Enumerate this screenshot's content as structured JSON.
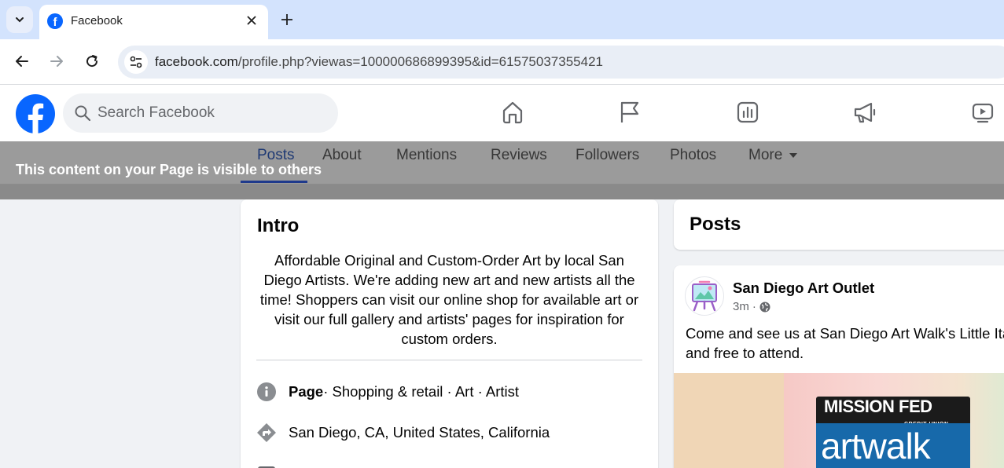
{
  "browser": {
    "tab": {
      "title": "Facebook"
    },
    "url": {
      "domain": "facebook.com",
      "path": "/profile.php?viewas=100000686899395&id=61575037355421"
    }
  },
  "fb": {
    "search": {
      "placeholder": "Search Facebook"
    },
    "logo_letter": "f"
  },
  "profile_tabs": [
    "Posts",
    "About",
    "Mentions",
    "Reviews",
    "Followers",
    "Photos",
    "More"
  ],
  "visibility_note": "This content on your Page is visible to others",
  "intro": {
    "title": "Intro",
    "bio": "Affordable Original and Custom-Order Art by local San Diego Artists. We're adding new art and new artists all the time! Shoppers can visit our online shop for available art or visit our full gallery and artists' pages for inspiration for custom orders.",
    "category_label": "Page",
    "category_rest": " · Shopping & retail · Art · Artist",
    "location": "San Diego, CA, United States, California"
  },
  "posts": {
    "title": "Posts",
    "post": {
      "author": "San Diego Art Outlet",
      "time": "3m",
      "separator": "·",
      "text_line1": "Come and see us at San Diego Art Walk's Little Ita",
      "text_line2": "and free to attend.",
      "image_logo_top": "MISSION FED",
      "image_logo_sub": "CREDIT UNION",
      "image_logo_bottom": "artwalk"
    }
  },
  "colors": {
    "fb_blue": "#0866ff",
    "chrome_tabbar": "#d3e3fd",
    "overlay": "#9b9b9b"
  }
}
